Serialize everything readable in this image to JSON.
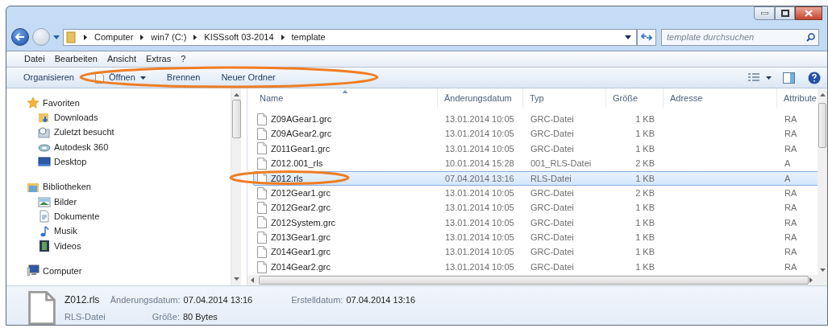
{
  "address_bar": {
    "crumbs": [
      "Computer",
      "win7 (C:)",
      "KISSsoft 03-2014",
      "template"
    ]
  },
  "search": {
    "placeholder": "template durchsuchen"
  },
  "menu": [
    "Datei",
    "Bearbeiten",
    "Ansicht",
    "Extras",
    "?"
  ],
  "toolbar": [
    {
      "label": "Organisieren",
      "dropdown": false,
      "icon": false
    },
    {
      "label": "Öffnen",
      "dropdown": true,
      "icon": true
    },
    {
      "label": "Brennen",
      "dropdown": false,
      "icon": false
    },
    {
      "label": "Neuer Ordner",
      "dropdown": false,
      "icon": false
    }
  ],
  "sidebar": [
    {
      "label": "Favoriten",
      "items": [
        "Downloads",
        "Zuletzt besucht",
        "Autodesk 360",
        "Desktop"
      ]
    },
    {
      "label": "Bibliotheken",
      "items": [
        "Bilder",
        "Dokumente",
        "Musik",
        "Videos"
      ]
    },
    {
      "label": "Computer"
    }
  ],
  "table": {
    "columns": [
      {
        "label": "Name",
        "sorted": true
      },
      {
        "label": "Änderungsdatum",
        "sorted": false
      },
      {
        "label": "Typ",
        "sorted": false
      },
      {
        "label": "Größe",
        "sorted": false
      },
      {
        "label": "Adresse",
        "sorted": false
      },
      {
        "label": "Attribute",
        "sorted": false
      }
    ],
    "rows": [
      {
        "name": "Z09AGear1.grc",
        "date": "13.01.2014 10:05",
        "type": "GRC-Datei",
        "size": "1 KB",
        "attributes": "RA",
        "selected": false
      },
      {
        "name": "Z09AGear2.grc",
        "date": "13.01.2014 10:05",
        "type": "GRC-Datei",
        "size": "1 KB",
        "attributes": "RA",
        "selected": false
      },
      {
        "name": "Z011Gear1.grc",
        "date": "13.01.2014 10:05",
        "type": "GRC-Datei",
        "size": "1 KB",
        "attributes": "RA",
        "selected": false
      },
      {
        "name": "Z012.001_rls",
        "date": "10.01.2014 15:28",
        "type": "001_RLS-Datei",
        "size": "2 KB",
        "attributes": "A",
        "selected": false
      },
      {
        "name": "Z012.rls",
        "date": "07.04.2014 13:16",
        "type": "RLS-Datei",
        "size": "1 KB",
        "attributes": "A",
        "selected": true
      },
      {
        "name": "Z012Gear1.grc",
        "date": "13.01.2014 10:05",
        "type": "GRC-Datei",
        "size": "2 KB",
        "attributes": "RA",
        "selected": false
      },
      {
        "name": "Z012Gear2.grc",
        "date": "13.01.2014 10:05",
        "type": "GRC-Datei",
        "size": "1 KB",
        "attributes": "RA",
        "selected": false
      },
      {
        "name": "Z012System.grc",
        "date": "13.01.2014 10:05",
        "type": "GRC-Datei",
        "size": "1 KB",
        "attributes": "RA",
        "selected": false
      },
      {
        "name": "Z013Gear1.grc",
        "date": "13.01.2014 10:05",
        "type": "GRC-Datei",
        "size": "1 KB",
        "attributes": "RA",
        "selected": false
      },
      {
        "name": "Z014Gear1.grc",
        "date": "13.01.2014 10:05",
        "type": "GRC-Datei",
        "size": "1 KB",
        "attributes": "RA",
        "selected": false
      },
      {
        "name": "Z014Gear2.grc",
        "date": "13.01.2014 10:05",
        "type": "GRC-Datei",
        "size": "1 KB",
        "attributes": "RA",
        "selected": false
      }
    ]
  },
  "details": {
    "name": "Z012.rls",
    "type": "RLS-Datei",
    "fields": [
      {
        "label": "Änderungsdatum:",
        "value": "07.04.2014 13:16"
      },
      {
        "label": "Größe:",
        "value": "80 Bytes"
      },
      {
        "label": "Erstelldatum:",
        "value": "07.04.2014 13:16"
      }
    ]
  }
}
